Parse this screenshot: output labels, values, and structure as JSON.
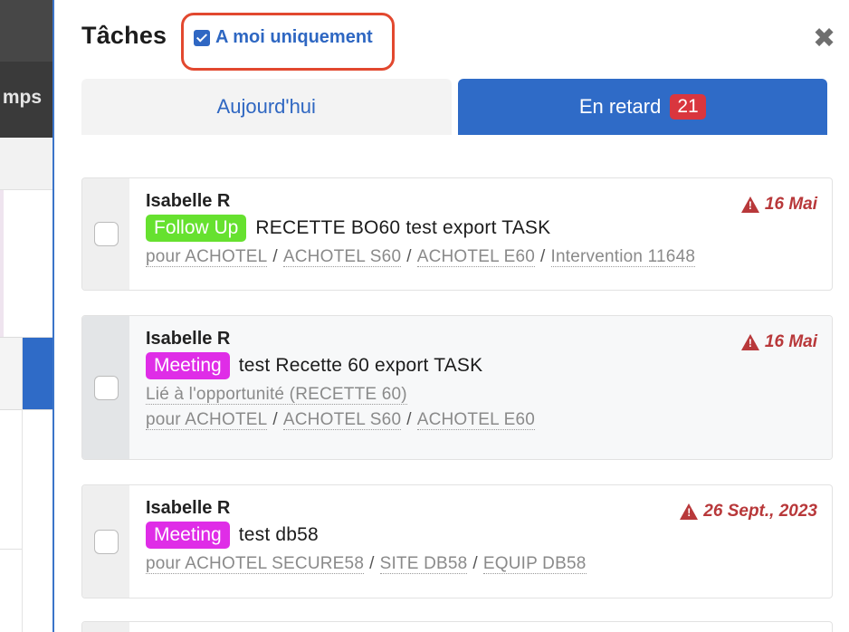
{
  "background": {
    "nav_label": "mps"
  },
  "panel": {
    "title": "Tâches",
    "filter_label": "A moi uniquement",
    "filter_checked": true,
    "close_symbol": "✖"
  },
  "tabs": [
    {
      "label": "Aujourd'hui",
      "active": false
    },
    {
      "label": "En retard",
      "active": true,
      "count": "21"
    }
  ],
  "tasks": [
    {
      "user": "Isabelle R",
      "date": "16 Mai",
      "tag": "Follow Up",
      "tag_color": "#66e12f",
      "title": "RECETTE BO60 test export TASK",
      "linked": "",
      "path": [
        "pour ACHOTEL",
        "ACHOTEL S60",
        "ACHOTEL E60",
        "Intervention 11648"
      ]
    },
    {
      "user": "Isabelle R",
      "date": "16 Mai",
      "tag": "Meeting",
      "tag_color": "#df2de7",
      "title": "test Recette 60 export TASK",
      "linked": "Lié à l'opportunité (RECETTE 60)",
      "path": [
        "pour ACHOTEL",
        "ACHOTEL S60",
        "ACHOTEL E60"
      ]
    },
    {
      "user": "Isabelle R",
      "date": "26 Sept., 2023",
      "tag": "Meeting",
      "tag_color": "#df2de7",
      "title": "test db58",
      "linked": "",
      "path": [
        "pour ACHOTEL SECURE58",
        "SITE DB58",
        "EQUIP DB58"
      ]
    }
  ],
  "colors": {
    "accent": "#2f6bc7",
    "badge": "#d9363e",
    "overdue": "#b8383a",
    "highlight_box": "#e2482f"
  }
}
